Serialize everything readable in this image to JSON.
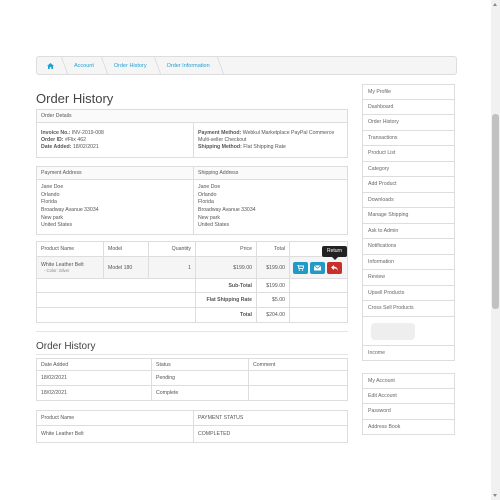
{
  "breadcrumb": {
    "items": [
      "Account",
      "Order History",
      "Order Information"
    ]
  },
  "page_title": "Order History",
  "order_details": {
    "header": "Order Details",
    "invoice_label": "Invoice No.:",
    "invoice_value": "INV-2019-008",
    "order_label": "Order ID:",
    "order_value": "#Flix 462",
    "date_label": "Date Added:",
    "date_value": "18/02/2021",
    "payment_label": "Payment Method:",
    "payment_value": "Webkul Marketplace PayPal Commerce",
    "payment_sub": "Multi-seller Checkout",
    "shipping_label": "Shipping Method:",
    "shipping_value": "Flat Shipping Rate"
  },
  "addresses": {
    "payment_header": "Payment Address",
    "shipping_header": "Shipping Address",
    "payment_lines": [
      "Jane Doe",
      "Orlando",
      "Florida",
      "Broadway Avanue 33034",
      "New park",
      "United States"
    ],
    "shipping_lines": [
      "Jane Doe",
      "Orlando",
      "Florida",
      "Broadway Avanue 33034",
      "New park",
      "United States"
    ]
  },
  "products": {
    "headers": [
      "Product Name",
      "Model",
      "Quantity",
      "Price",
      "Total"
    ],
    "row": {
      "name": "White Leather Belt",
      "option": "- Color: Silver",
      "model": "Model 180",
      "qty": "1",
      "price": "$199.00",
      "total": "$199.00"
    },
    "return_tooltip": "Return",
    "totals": [
      {
        "label": "Sub-Total",
        "value": "$199.00"
      },
      {
        "label": "Flat Shipping Rate",
        "value": "$5.00"
      },
      {
        "label": "Total",
        "value": "$204.00"
      }
    ]
  },
  "history": {
    "title": "Order History",
    "headers": [
      "Date Added",
      "Status",
      "Comment"
    ],
    "rows": [
      {
        "date": "18/02/2021",
        "status": "Pending",
        "comment": ""
      },
      {
        "date": "18/02/2021",
        "status": "Complete",
        "comment": ""
      }
    ]
  },
  "payment_status": {
    "headers": [
      "Product Name",
      "PAYMENT STATUS"
    ],
    "rows": [
      {
        "name": "White Leather Belt",
        "status": "COMPLETED"
      }
    ]
  },
  "sidebar": {
    "group1": [
      "My Profile",
      "Dashboard",
      "Order History",
      "Transactions",
      "Product List",
      "Category",
      "Add Product",
      "Downloads",
      "Manage Shipping",
      "Ask to Admin",
      "Notifications",
      "Information",
      "Review",
      "Upsell Products",
      "Cross Sell Products"
    ],
    "group2": [
      "Income"
    ],
    "group3": [
      "My Account",
      "Edit Account",
      "Password",
      "Address Book"
    ]
  },
  "colors": {
    "accent": "#23a1d1",
    "button_blue": "#229ac8",
    "button_red": "#c9302c"
  }
}
